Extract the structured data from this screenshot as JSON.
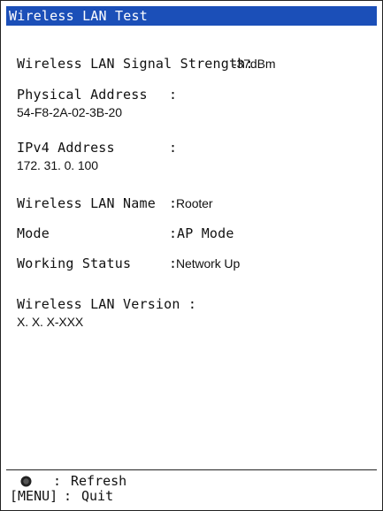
{
  "title": "Wireless LAN Test",
  "fields": {
    "signal": {
      "label": "Wireless LAN Signal Strength:",
      "value": "-37dBm"
    },
    "mac": {
      "label": "Physical Address",
      "sep": ":",
      "value": "54-F8-2A-02-3B-20"
    },
    "ipv4": {
      "label": "IPv4 Address",
      "sep": ":",
      "value": "172. 31. 0. 100"
    },
    "ssid": {
      "label": "Wireless LAN Name",
      "sep": ":",
      "value": "Rooter"
    },
    "mode": {
      "label": "Mode",
      "sep": ":",
      "value": "AP Mode"
    },
    "status": {
      "label": "Working Status",
      "sep": ":",
      "value": "Network Up"
    },
    "version": {
      "label": "Wireless LAN Version :",
      "value": "X. X. X-XXX"
    }
  },
  "footer": {
    "refresh": {
      "key_icon": "rotary-knob-icon",
      "sep": ":",
      "text": "Refresh"
    },
    "quit": {
      "key": "[MENU]",
      "sep": ":",
      "text": "Quit"
    }
  }
}
